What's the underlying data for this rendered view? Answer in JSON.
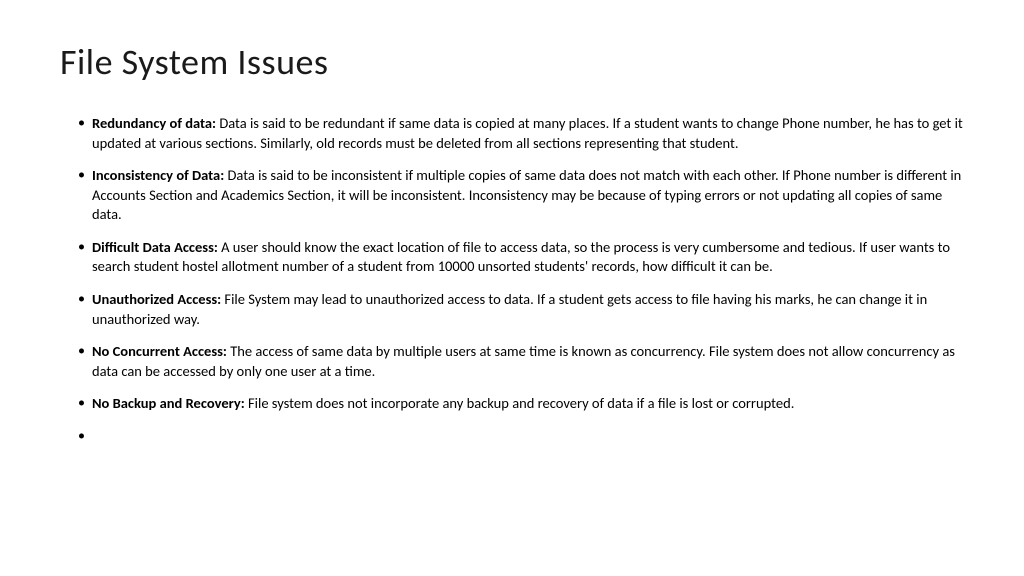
{
  "slide": {
    "title": "File System Issues",
    "bullets": [
      {
        "label": "Redundancy of data:",
        "text": " Data is said to be redundant if same data is copied at many places. If a student wants to change Phone number, he has to get it updated at various sections. Similarly, old records must be deleted from all sections representing that student."
      },
      {
        "label": "Inconsistency of Data:",
        "text": " Data is said to be inconsistent if multiple copies of same data does not match with each other. If Phone number is different in Accounts Section and Academics Section, it will be inconsistent. Inconsistency may be because of typing errors or not updating all copies of same data."
      },
      {
        "label": "Difficult Data Access:",
        "text": " A user should know the exact location of file to access data, so the process is very cumbersome and tedious. If user wants to search student hostel allotment number of a student from 10000 unsorted students' records, how difficult it can be."
      },
      {
        "label": "Unauthorized Access:",
        "text": " File System may lead to unauthorized access to data. If a student gets access to file having his marks, he can change it in unauthorized way."
      },
      {
        "label": "No Concurrent Access:",
        "text": " The access of same data by multiple users at same time is known as concurrency. File system does not allow concurrency as data can be accessed by only one user at a time."
      },
      {
        "label": "No Backup and Recovery:",
        "text": " File system does not incorporate any backup and recovery of data if a file is lost or corrupted."
      },
      {
        "label": "",
        "text": ""
      }
    ]
  }
}
